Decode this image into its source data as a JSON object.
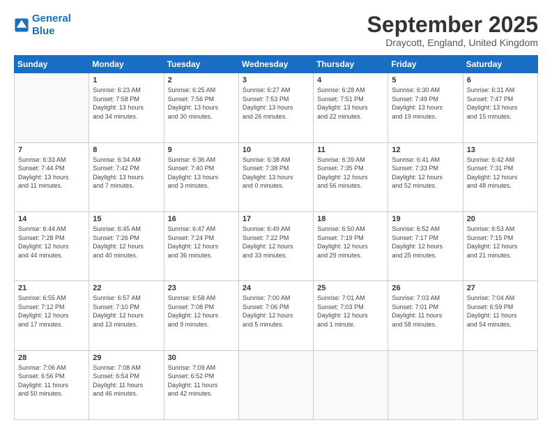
{
  "header": {
    "logo_line1": "General",
    "logo_line2": "Blue",
    "month": "September 2025",
    "location": "Draycott, England, United Kingdom"
  },
  "weekdays": [
    "Sunday",
    "Monday",
    "Tuesday",
    "Wednesday",
    "Thursday",
    "Friday",
    "Saturday"
  ],
  "weeks": [
    [
      {
        "day": "",
        "text": ""
      },
      {
        "day": "1",
        "text": "Sunrise: 6:23 AM\nSunset: 7:58 PM\nDaylight: 13 hours\nand 34 minutes."
      },
      {
        "day": "2",
        "text": "Sunrise: 6:25 AM\nSunset: 7:56 PM\nDaylight: 13 hours\nand 30 minutes."
      },
      {
        "day": "3",
        "text": "Sunrise: 6:27 AM\nSunset: 7:53 PM\nDaylight: 13 hours\nand 26 minutes."
      },
      {
        "day": "4",
        "text": "Sunrise: 6:28 AM\nSunset: 7:51 PM\nDaylight: 13 hours\nand 22 minutes."
      },
      {
        "day": "5",
        "text": "Sunrise: 6:30 AM\nSunset: 7:49 PM\nDaylight: 13 hours\nand 19 minutes."
      },
      {
        "day": "6",
        "text": "Sunrise: 6:31 AM\nSunset: 7:47 PM\nDaylight: 13 hours\nand 15 minutes."
      }
    ],
    [
      {
        "day": "7",
        "text": "Sunrise: 6:33 AM\nSunset: 7:44 PM\nDaylight: 13 hours\nand 11 minutes."
      },
      {
        "day": "8",
        "text": "Sunrise: 6:34 AM\nSunset: 7:42 PM\nDaylight: 13 hours\nand 7 minutes."
      },
      {
        "day": "9",
        "text": "Sunrise: 6:36 AM\nSunset: 7:40 PM\nDaylight: 13 hours\nand 3 minutes."
      },
      {
        "day": "10",
        "text": "Sunrise: 6:38 AM\nSunset: 7:38 PM\nDaylight: 13 hours\nand 0 minutes."
      },
      {
        "day": "11",
        "text": "Sunrise: 6:39 AM\nSunset: 7:35 PM\nDaylight: 12 hours\nand 56 minutes."
      },
      {
        "day": "12",
        "text": "Sunrise: 6:41 AM\nSunset: 7:33 PM\nDaylight: 12 hours\nand 52 minutes."
      },
      {
        "day": "13",
        "text": "Sunrise: 6:42 AM\nSunset: 7:31 PM\nDaylight: 12 hours\nand 48 minutes."
      }
    ],
    [
      {
        "day": "14",
        "text": "Sunrise: 6:44 AM\nSunset: 7:28 PM\nDaylight: 12 hours\nand 44 minutes."
      },
      {
        "day": "15",
        "text": "Sunrise: 6:45 AM\nSunset: 7:26 PM\nDaylight: 12 hours\nand 40 minutes."
      },
      {
        "day": "16",
        "text": "Sunrise: 6:47 AM\nSunset: 7:24 PM\nDaylight: 12 hours\nand 36 minutes."
      },
      {
        "day": "17",
        "text": "Sunrise: 6:49 AM\nSunset: 7:22 PM\nDaylight: 12 hours\nand 33 minutes."
      },
      {
        "day": "18",
        "text": "Sunrise: 6:50 AM\nSunset: 7:19 PM\nDaylight: 12 hours\nand 29 minutes."
      },
      {
        "day": "19",
        "text": "Sunrise: 6:52 AM\nSunset: 7:17 PM\nDaylight: 12 hours\nand 25 minutes."
      },
      {
        "day": "20",
        "text": "Sunrise: 6:53 AM\nSunset: 7:15 PM\nDaylight: 12 hours\nand 21 minutes."
      }
    ],
    [
      {
        "day": "21",
        "text": "Sunrise: 6:55 AM\nSunset: 7:12 PM\nDaylight: 12 hours\nand 17 minutes."
      },
      {
        "day": "22",
        "text": "Sunrise: 6:57 AM\nSunset: 7:10 PM\nDaylight: 12 hours\nand 13 minutes."
      },
      {
        "day": "23",
        "text": "Sunrise: 6:58 AM\nSunset: 7:08 PM\nDaylight: 12 hours\nand 9 minutes."
      },
      {
        "day": "24",
        "text": "Sunrise: 7:00 AM\nSunset: 7:06 PM\nDaylight: 12 hours\nand 5 minutes."
      },
      {
        "day": "25",
        "text": "Sunrise: 7:01 AM\nSunset: 7:03 PM\nDaylight: 12 hours\nand 1 minute."
      },
      {
        "day": "26",
        "text": "Sunrise: 7:03 AM\nSunset: 7:01 PM\nDaylight: 11 hours\nand 58 minutes."
      },
      {
        "day": "27",
        "text": "Sunrise: 7:04 AM\nSunset: 6:59 PM\nDaylight: 11 hours\nand 54 minutes."
      }
    ],
    [
      {
        "day": "28",
        "text": "Sunrise: 7:06 AM\nSunset: 6:56 PM\nDaylight: 11 hours\nand 50 minutes."
      },
      {
        "day": "29",
        "text": "Sunrise: 7:08 AM\nSunset: 6:54 PM\nDaylight: 11 hours\nand 46 minutes."
      },
      {
        "day": "30",
        "text": "Sunrise: 7:09 AM\nSunset: 6:52 PM\nDaylight: 11 hours\nand 42 minutes."
      },
      {
        "day": "",
        "text": ""
      },
      {
        "day": "",
        "text": ""
      },
      {
        "day": "",
        "text": ""
      },
      {
        "day": "",
        "text": ""
      }
    ]
  ]
}
